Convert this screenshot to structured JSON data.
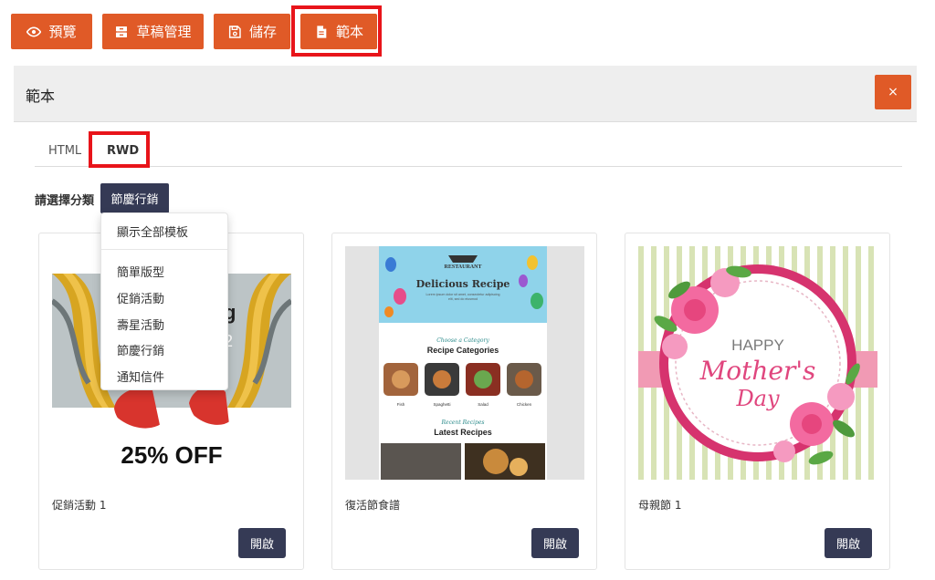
{
  "toolbar": {
    "preview_label": "預覽",
    "drafts_label": "草稿管理",
    "save_label": "儲存",
    "templates_label": "範本",
    "button_color": "#e05a27",
    "highlight_color": "#e8141a"
  },
  "panel": {
    "title": "範本",
    "close_label": "×"
  },
  "tabs": [
    {
      "label": "HTML"
    },
    {
      "label": "RWD"
    }
  ],
  "category": {
    "label": "請選擇分類",
    "selected": "節慶行銷"
  },
  "menu": {
    "items": [
      {
        "label": "顯示全部模板"
      },
      {
        "label": "簡單版型"
      },
      {
        "label": "促銷活動"
      },
      {
        "label": "壽星活動"
      },
      {
        "label": "節慶行銷"
      },
      {
        "label": "通知信件"
      }
    ]
  },
  "cards": [
    {
      "title": "促銷活動 1",
      "open_label": "開啟",
      "thumb": {
        "banner_text_1": "g",
        "banner_text_2": "2",
        "offer": "25% OFF"
      }
    },
    {
      "title": "復活節食譜",
      "open_label": "開啟",
      "thumb": {
        "brand": "RESTAURANT",
        "heading": "Delicious Recipe",
        "blurb_1": "Lorem ipsum dolor sit amet, consectetur adipiscing",
        "blurb_2": "elit, sed do eiusmod",
        "cat_script": "Choose a Category",
        "cat_title": "Recipe Categories",
        "categories": [
          "Fish",
          "Spaghetti",
          "Salad",
          "Chicken"
        ],
        "recent_script": "Recent Recipes",
        "recent_title": "Latest Recipes"
      }
    },
    {
      "title": "母親節 1",
      "open_label": "開啟",
      "thumb": {
        "line1": "HAPPY",
        "line2": "Mother's",
        "line3": "Day"
      }
    }
  ]
}
